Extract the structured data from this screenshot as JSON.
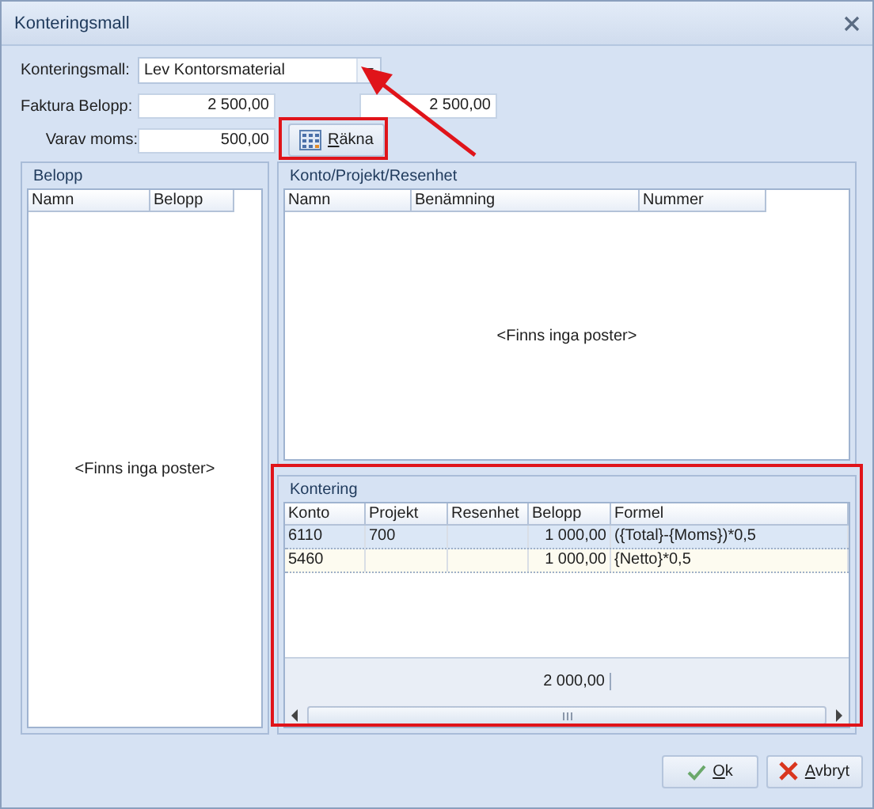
{
  "window": {
    "title": "Konteringsmall"
  },
  "form": {
    "template_label": "Konteringsmall:",
    "template_value": "Lev Kontorsmaterial",
    "invoice_label": "Faktura Belopp:",
    "invoice_value": "2 500,00",
    "invoice_value_2": "2 500,00",
    "vat_label": "Varav moms:",
    "vat_value": "500,00",
    "calc_button": "Räkna"
  },
  "belopp_panel": {
    "title": "Belopp",
    "columns": [
      "Namn",
      "Belopp"
    ],
    "empty_text": "<Finns inga poster>"
  },
  "konto_panel": {
    "title": "Konto/Projekt/Resenhet",
    "columns": [
      "Namn",
      "Benämning",
      "Nummer"
    ],
    "empty_text": "<Finns inga poster>"
  },
  "kontering_panel": {
    "title": "Kontering",
    "columns": [
      "Konto",
      "Projekt",
      "Resenhet",
      "Belopp",
      "Formel"
    ],
    "rows": [
      {
        "cells": [
          "6110",
          "700",
          "",
          "1 000,00",
          "({Total}-{Moms})*0,5"
        ],
        "selected": true
      },
      {
        "cells": [
          "5460",
          "",
          "",
          "1 000,00",
          "{Netto}*0,5"
        ],
        "selected": false
      }
    ],
    "total": "2 000,00"
  },
  "buttons": [
    {
      "label": "Ok",
      "kind": "ok"
    },
    {
      "label": "Avbryt",
      "kind": "cancel"
    }
  ]
}
